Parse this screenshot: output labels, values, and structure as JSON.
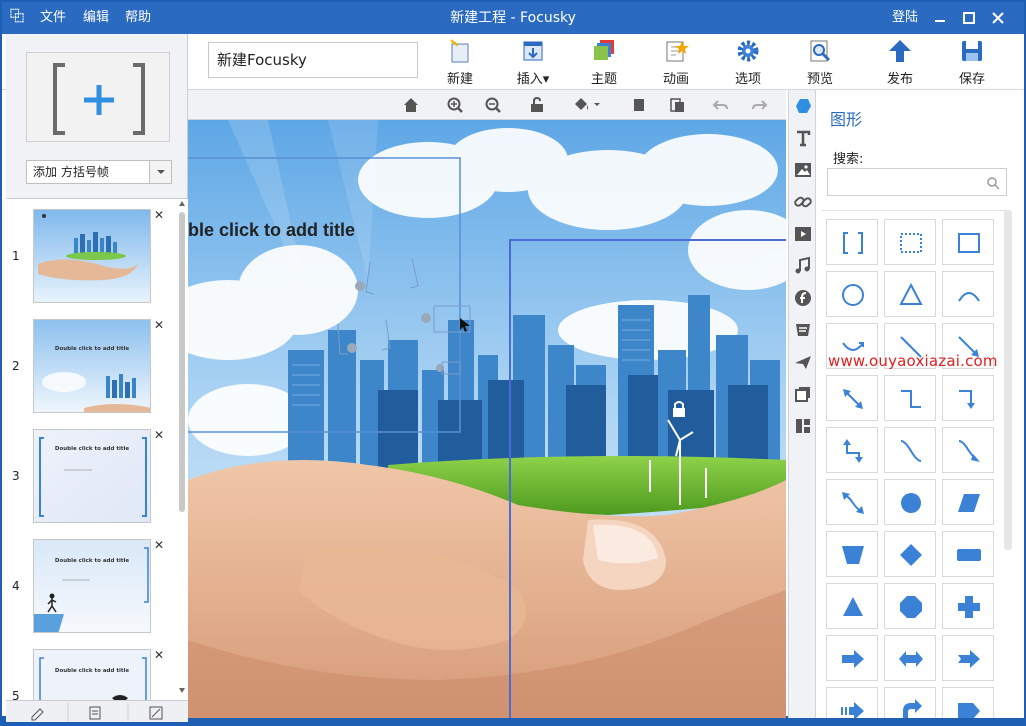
{
  "titlebar": {
    "logo_glyph": "⿻",
    "menu": [
      "文件",
      "编辑",
      "帮助"
    ],
    "window_title": "新建工程 - Focusky",
    "login": "登陆"
  },
  "toolbar": {
    "project_name": "新建Focusky",
    "buttons": [
      "新建",
      "插入",
      "主题",
      "动画",
      "选项",
      "预览",
      "发布",
      "保存"
    ]
  },
  "left": {
    "frame_type": "添加 方括号帧",
    "slides": [
      {
        "num": "1",
        "text": ""
      },
      {
        "num": "2",
        "text": "Double click to add title"
      },
      {
        "num": "3",
        "text": "Double click to add title"
      },
      {
        "num": "4",
        "text": "Double click to add title"
      },
      {
        "num": "5",
        "text": "Double click to add title"
      }
    ]
  },
  "canvas": {
    "title_text": "ble click to add title"
  },
  "shapes": {
    "title": "图形",
    "search_label": "搜索:",
    "search_placeholder": ""
  },
  "watermark": "www.ouyaoxiazai.com",
  "colors": {
    "accent": "#2a6ac0",
    "icon_blue": "#3b82d6",
    "frame_line": "#4a6cd4"
  }
}
